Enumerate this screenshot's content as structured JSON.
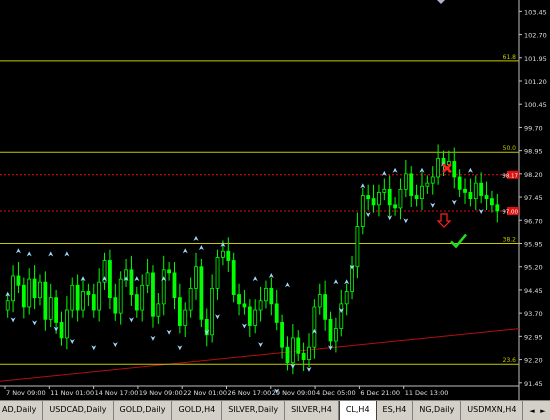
{
  "chart_data": {
    "type": "candlestick",
    "symbol": "CL,H4",
    "ylim": [
      91.12,
      103.72
    ],
    "price_labels": [
      "103.45",
      "102.70",
      "101.95",
      "101.20",
      "100.45",
      "99.70",
      "98.95",
      "98.20",
      "97.45",
      "96.70",
      "95.95",
      "95.20",
      "94.45",
      "93.70",
      "92.95",
      "92.20",
      "91.45"
    ],
    "time_labels": [
      "7 Nov 09:00",
      "11 Nov 01:00",
      "14 Nov 17:00",
      "19 Nov 09:00",
      "22 Nov 01:00",
      "26 Nov 17:00",
      "29 Nov 09:00",
      "4 Dec 05:00",
      "6 Dec 21:00",
      "11 Dec 13:00"
    ],
    "fib_levels": [
      {
        "label": "61.8",
        "price": 101.85,
        "color": "#c8c800"
      },
      {
        "label": "50.0",
        "price": 98.9,
        "color": "#c8c800"
      },
      {
        "label": "38.2",
        "price": 95.95,
        "color": "#c8c800"
      },
      {
        "label": "23.6",
        "price": 92.05,
        "color": "#c8c800"
      }
    ],
    "price_tags": [
      {
        "text": "98.17",
        "price": 98.17,
        "color": "#e01010"
      },
      {
        "text": "97.00",
        "price": 97.0,
        "color": "#e01010"
      }
    ],
    "close_path": [
      94.1,
      94.9,
      94.6,
      93.9,
      94.8,
      94.2,
      94.7,
      93.5,
      94.2,
      93.4,
      92.9,
      93.8,
      94.6,
      93.8,
      94.4,
      94.3,
      93.8,
      94.7,
      95.4,
      94.2,
      93.7,
      94.8,
      95.1,
      94.3,
      93.8,
      94.6,
      95.0,
      93.6,
      94.0,
      95.1,
      95.0,
      94.2,
      93.3,
      93.8,
      94.5,
      95.2,
      93.5,
      93.0,
      94.5,
      95.5,
      95.7,
      95.4,
      94.3,
      94.0,
      93.9,
      93.3,
      93.8,
      94.1,
      94.5,
      94.0,
      93.4,
      92.6,
      92.1,
      92.9,
      92.4,
      92.2,
      92.6,
      93.9,
      94.3,
      93.5,
      92.8,
      93.2,
      94.0,
      94.4,
      95.2,
      96.5,
      97.5,
      97.4,
      97.2,
      97.6,
      97.7,
      97.2,
      97.1,
      97.7,
      98.2,
      97.5,
      97.4,
      97.8,
      97.9,
      98.1,
      98.7,
      98.5,
      98.6,
      98.1,
      97.7,
      97.6,
      97.4,
      97.9,
      97.5,
      97.4,
      97.2,
      97.0
    ],
    "arrows_up": [
      [
        0,
        94.3
      ],
      [
        2,
        95.7
      ],
      [
        4,
        95.6
      ],
      [
        8,
        95.6
      ],
      [
        11,
        95.6
      ],
      [
        14,
        94.8
      ],
      [
        18,
        94.8
      ],
      [
        22,
        94.8
      ],
      [
        24,
        94.8
      ],
      [
        29,
        94.8
      ],
      [
        33,
        95.7
      ],
      [
        35,
        96.1
      ],
      [
        36,
        95.8
      ],
      [
        40,
        95.9
      ],
      [
        46,
        94.8
      ],
      [
        49,
        94.9
      ],
      [
        52,
        94.6
      ],
      [
        57,
        93.1
      ],
      [
        61,
        94.7
      ],
      [
        63,
        94.7
      ],
      [
        66,
        97.8
      ],
      [
        70,
        98.2
      ],
      [
        72,
        98.3
      ],
      [
        77,
        98.3
      ],
      [
        81,
        98.5
      ],
      [
        86,
        98.3
      ]
    ],
    "arrows_down": [
      [
        1,
        93.5
      ],
      [
        5,
        93.4
      ],
      [
        9,
        93.2
      ],
      [
        12,
        92.8
      ],
      [
        16,
        92.6
      ],
      [
        20,
        92.7
      ],
      [
        23,
        93.5
      ],
      [
        27,
        92.9
      ],
      [
        30,
        93.1
      ],
      [
        32,
        92.6
      ],
      [
        37,
        93.1
      ],
      [
        39,
        93.6
      ],
      [
        44,
        93.3
      ],
      [
        47,
        92.7
      ],
      [
        50,
        91.2
      ],
      [
        53,
        92.0
      ],
      [
        56,
        91.9
      ],
      [
        60,
        92.6
      ],
      [
        62,
        93.8
      ],
      [
        64,
        95.2
      ],
      [
        67,
        96.9
      ],
      [
        71,
        96.8
      ],
      [
        74,
        96.7
      ],
      [
        79,
        97.2
      ],
      [
        83,
        97.3
      ],
      [
        88,
        97.0
      ]
    ],
    "trendline": {
      "from": 91.5,
      "to": 93.2,
      "color": "#b01010"
    }
  },
  "markers": {
    "cross": "x-mark",
    "arrow": "down-arrow",
    "check": "check-mark"
  },
  "tabs": [
    {
      "label": "AD,Daily",
      "active": false
    },
    {
      "label": "USDCAD,Daily",
      "active": false
    },
    {
      "label": "GOLD,Daily",
      "active": false
    },
    {
      "label": "GOLD,H4",
      "active": false
    },
    {
      "label": "SILVER,Daily",
      "active": false
    },
    {
      "label": "SILVER,H4",
      "active": false
    },
    {
      "label": "CL,H4",
      "active": true
    },
    {
      "label": "ES,H4",
      "active": false
    },
    {
      "label": "NG,Daily",
      "active": false
    },
    {
      "label": "USDMXN,H4",
      "active": false
    }
  ],
  "scroll": {
    "left": "◄",
    "right": "►"
  }
}
